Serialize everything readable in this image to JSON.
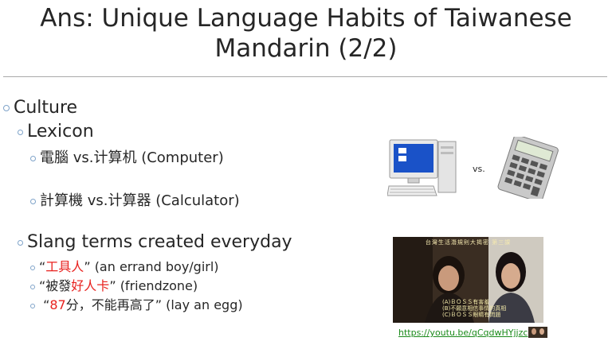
{
  "slide": {
    "title_line1": "Ans: Unique Language Habits of Taiwanese",
    "title_line2": "Mandarin (2/2)"
  },
  "bullets": {
    "culture": "Culture",
    "lexicon": "Lexicon",
    "computer": "電腦 vs.计算机 (Computer)",
    "calculator": "計算機 vs.计算器 (Calculator)",
    "slang": "Slang terms created everyday",
    "slang1_open": "“",
    "slang1_red": "工具人",
    "slang1_rest": "” (an errand boy/girl)",
    "slang2_pre": "“被發",
    "slang2_red": "好人卡",
    "slang2_rest": "” (friendzone)",
    "slang3_open": " “",
    "slang3_red": "87",
    "slang3_rest": "分，不能再高了” (lay an egg)"
  },
  "images": {
    "vs_label": "vs.",
    "video_title": "台灣生活潛規則大揭密 第三課",
    "video_caption": [
      "(A)ＢＯＳＳ有害羞",
      "(B)不願意相信事情的真相",
      "(C)ＢＯＳＳ眼睛有問題"
    ],
    "video_link": "https://youtu.be/qCqdwHYjjzc"
  },
  "colors": {
    "accent_red": "#e8221f",
    "bullet": "#7fa3c9",
    "link": "#1a8a1a"
  }
}
